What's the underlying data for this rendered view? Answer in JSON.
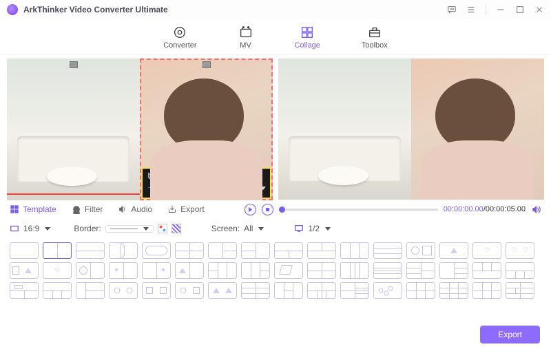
{
  "app": {
    "title": "ArkThinker Video Converter Ultimate"
  },
  "nav": {
    "items": [
      {
        "label": "Converter"
      },
      {
        "label": "MV"
      },
      {
        "label": "Collage"
      },
      {
        "label": "Toolbox"
      }
    ],
    "active": 2
  },
  "tabs": {
    "template": "Template",
    "filter": "Filter",
    "audio": "Audio",
    "export": "Export",
    "active": "template"
  },
  "player": {
    "current": "00:00:00.00",
    "duration": "00:00:05.00"
  },
  "options": {
    "aspect": "16:9",
    "border_label": "Border:",
    "screen_label": "Screen:",
    "screen_value": "All",
    "page": "1/2"
  },
  "footer": {
    "export": "Export"
  }
}
